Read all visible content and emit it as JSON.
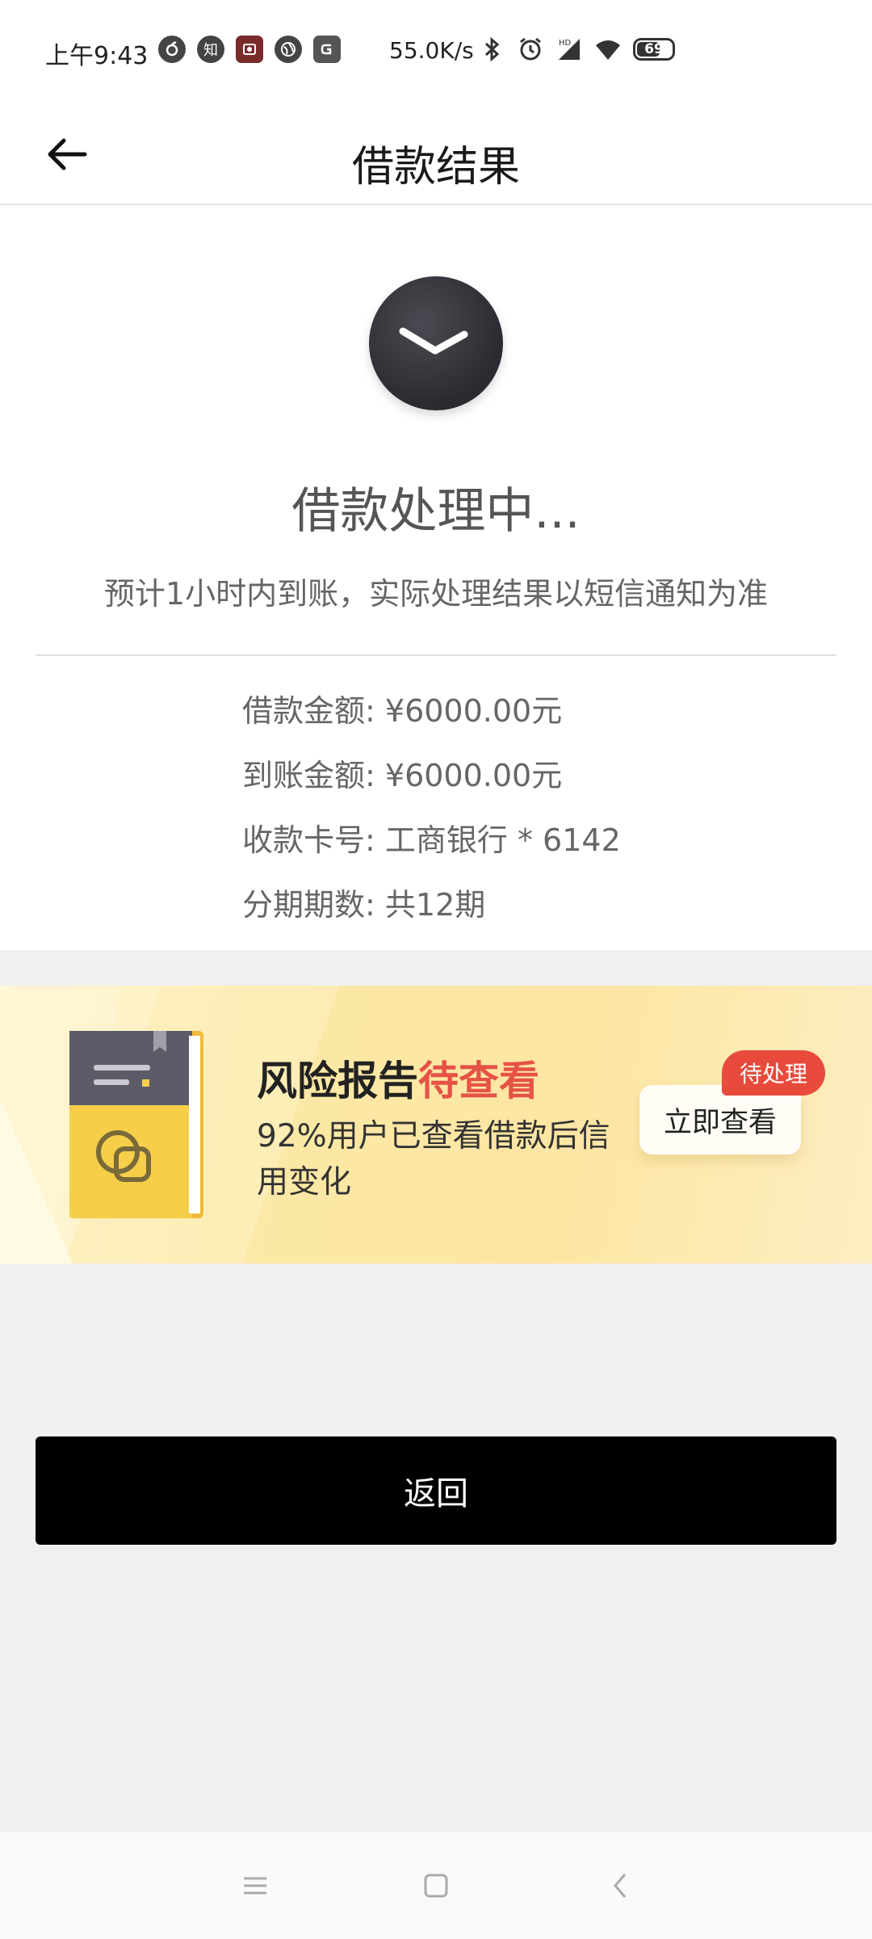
{
  "status_bar": {
    "time": "上午9:43",
    "app_icons": [
      "netease-music-icon",
      "zhihu-icon",
      "weibo-icon",
      "browser-icon",
      "game-icon"
    ],
    "zhihu_glyph": "知",
    "net_speed": "55.0K/s",
    "battery": "69"
  },
  "navbar": {
    "title": "借款结果"
  },
  "status": {
    "title": "借款处理中...",
    "subtitle": "预计1小时内到账，实际处理结果以短信通知为准"
  },
  "details": [
    {
      "label": "借款金额: ",
      "value": "¥6000.00元"
    },
    {
      "label": "到账金额: ",
      "value": "¥6000.00元"
    },
    {
      "label": "收款卡号: ",
      "value": "工商银行 * 6142"
    },
    {
      "label": "分期期数: ",
      "value": "共12期"
    }
  ],
  "banner": {
    "title_main": "风险报告",
    "title_highlight": "待查看",
    "description": "92%用户已查看借款后信用变化",
    "badge": "待处理",
    "button": "立即查看",
    "highlight_color": "#e65246"
  },
  "actions": {
    "return_label": "返回"
  },
  "colors": {
    "primary_button": "#000000",
    "badge": "#e84b3c",
    "background": "#f0f0f0"
  }
}
